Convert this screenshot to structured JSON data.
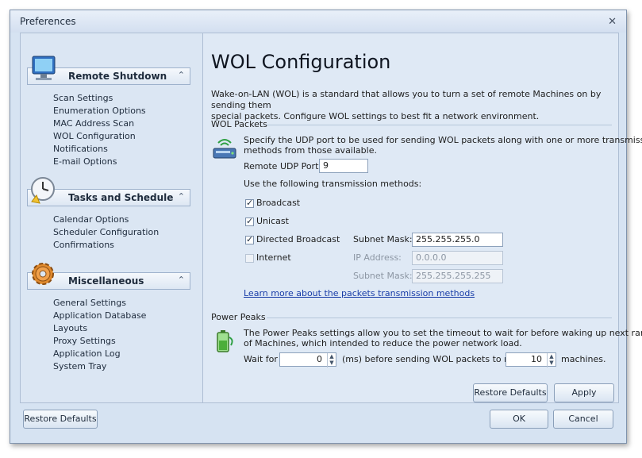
{
  "window": {
    "title": "Preferences",
    "close_glyph": "✕"
  },
  "sidebar": {
    "groups": [
      {
        "label": "Remote Shutdown",
        "icon": "monitor-icon",
        "items": [
          "Scan Settings",
          "Enumeration Options",
          "MAC Address Scan",
          "WOL Configuration",
          "Notifications",
          "E-mail Options"
        ]
      },
      {
        "label": "Tasks and Schedule",
        "icon": "clock-icon",
        "items": [
          "Calendar Options",
          "Scheduler Configuration",
          "Confirmations"
        ]
      },
      {
        "label": "Miscellaneous",
        "icon": "gear-icon",
        "items": [
          "General Settings",
          "Application Database",
          "Layouts",
          "Proxy Settings",
          "Application Log",
          "System Tray"
        ]
      }
    ],
    "chevron_glyph": "⌃"
  },
  "content": {
    "title": "WOL Configuration",
    "description_line1": "Wake-on-LAN (WOL) is a standard that allows you to turn a set of remote Machines on by sending them",
    "description_line2": "special packets. Configure WOL settings to best fit a network environment.",
    "wol_packets": {
      "section_title": "WOL Packets",
      "icon": "network-device-icon",
      "desc_line1": "Specify the UDP port to be used for sending WOL packets along with one or more transmission",
      "desc_line2": "methods from those available.",
      "port_label": "Remote UDP Port:",
      "port_value": "9",
      "methods_label": "Use the following transmission methods:",
      "methods": [
        {
          "label": "Broadcast",
          "checked": true
        },
        {
          "label": "Unicast",
          "checked": true
        },
        {
          "label": "Directed Broadcast",
          "checked": true
        },
        {
          "label": "Internet",
          "checked": false
        }
      ],
      "subnet_mask_label": "Subnet Mask:",
      "subnet_mask_value": "255.255.255.0",
      "ip_label": "IP Address:",
      "ip_value": "0.0.0.0",
      "subnet_mask2_label": "Subnet Mask:",
      "subnet_mask2_value": "255.255.255.255",
      "learn_more": "Learn more about the packets transmission methods"
    },
    "power_peaks": {
      "section_title": "Power Peaks",
      "icon": "battery-icon",
      "desc_line1": "The Power Peaks settings allow you to set the timeout to wait for before waking up next range",
      "desc_line2": "of Machines, which intended to reduce the power network load.",
      "wait_label": "Wait for",
      "wait_value": "0",
      "ms_label": "(ms) before sending WOL packets to next",
      "next_value": "10",
      "machines_label": "machines."
    },
    "restore_defaults": "Restore Defaults",
    "apply": "Apply"
  },
  "footer": {
    "restore_defaults": "Restore Defaults",
    "ok": "OK",
    "cancel": "Cancel"
  },
  "spin_up": "▲",
  "spin_down": "▼"
}
